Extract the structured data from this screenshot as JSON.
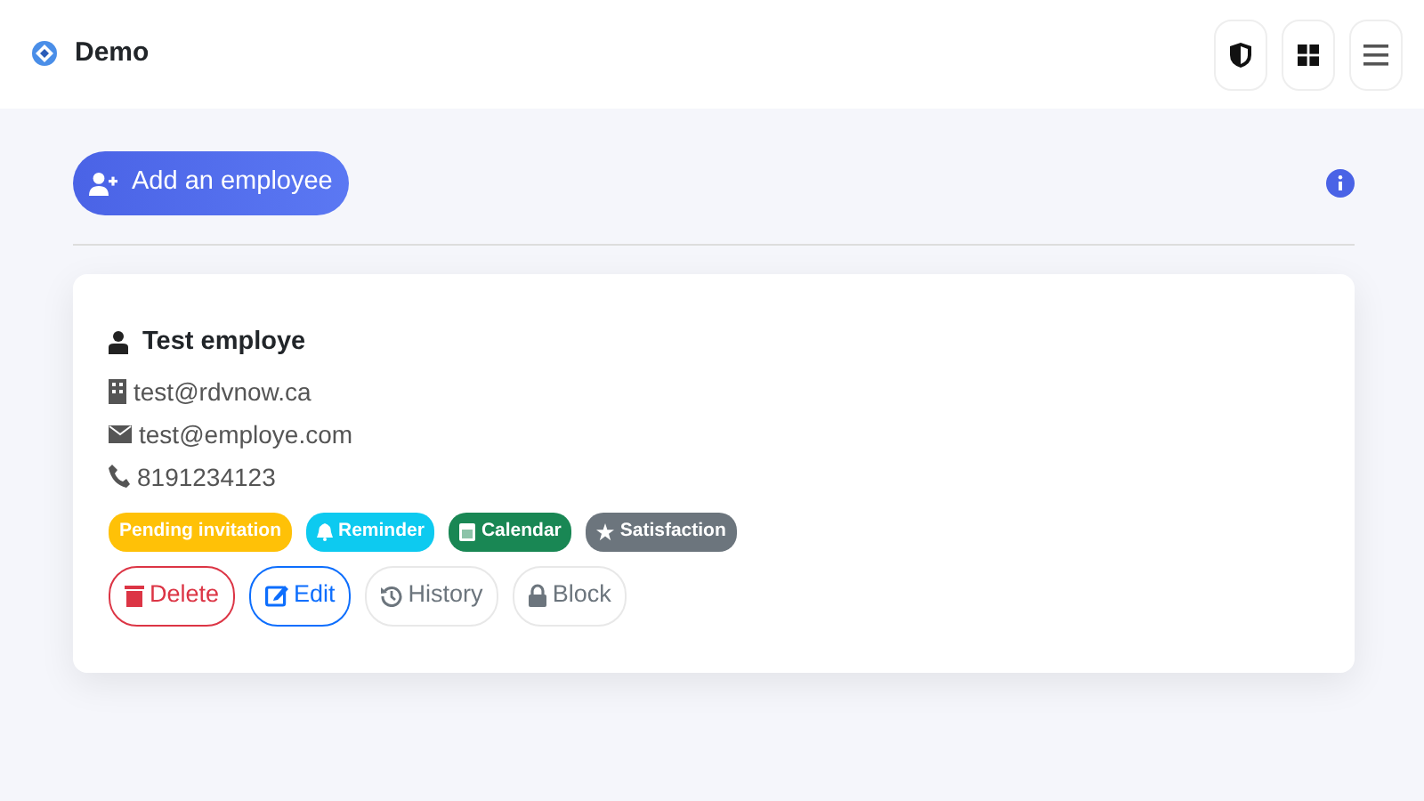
{
  "header": {
    "brand": "Demo",
    "buttons": [
      {
        "kind": "shield"
      },
      {
        "kind": "grid"
      },
      {
        "kind": "menu"
      }
    ]
  },
  "toolbar": {
    "add_button": "Add an employee"
  },
  "employee": {
    "name": "Test employe",
    "details": [
      {
        "kind": "building",
        "text": "test@rdvnow.ca"
      },
      {
        "kind": "envelope",
        "text": "test@employe.com"
      },
      {
        "kind": "phone",
        "text": "8191234123"
      }
    ],
    "tags": [
      {
        "kind": "none",
        "label": "Pending invitation",
        "color": "#ffc107"
      },
      {
        "kind": "bell",
        "label": "Reminder",
        "color": "#0dcaf0"
      },
      {
        "kind": "calendar",
        "label": "Calendar",
        "color": "#198754"
      },
      {
        "kind": "star",
        "label": "Satisfaction",
        "color": "#6c757d"
      }
    ],
    "actions": [
      {
        "kind": "trash",
        "label": "Delete",
        "color": "#dc3545"
      },
      {
        "kind": "edit",
        "label": "Edit",
        "color": "#0d6efd"
      },
      {
        "kind": "history",
        "label": "History",
        "color": "#6c757d"
      },
      {
        "kind": "lock",
        "label": "Block",
        "color": "#6c757d"
      }
    ]
  }
}
